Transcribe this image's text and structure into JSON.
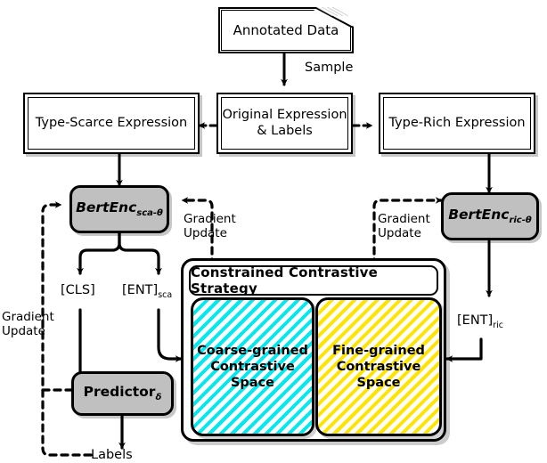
{
  "diagram": {
    "title": "Constrained Contrastive Strategy framework",
    "colors": {
      "coarse_hatch": "#00e8f0",
      "fine_hatch": "#ffe400",
      "process_fill": "#c0c0c0",
      "line": "#000000",
      "background": "#ffffff"
    }
  },
  "nodes": {
    "annotated_data": {
      "label": "Annotated Data"
    },
    "type_scarce": {
      "label": "Type-Scarce Expression"
    },
    "original": {
      "label_line1": "Original Expression",
      "label_line2": "& Labels"
    },
    "type_rich": {
      "label": "Type-Rich Expression"
    },
    "bert_sca": {
      "label": "BertEnc",
      "subscript": "sca-θ"
    },
    "bert_ric": {
      "label": "BertEnc",
      "subscript": "ric-θ"
    },
    "predictor": {
      "label": "Predictor",
      "subscript": "δ"
    },
    "ccs_panel": {
      "title": "Constrained Contrastive Strategy"
    },
    "coarse_space": {
      "label_line1": "Coarse-grained",
      "label_line2": "Contrastive Space"
    },
    "fine_space": {
      "label_line1": "Fine-grained",
      "label_line2": "Contrastive Space"
    }
  },
  "tokens": {
    "cls": {
      "label": "[CLS]"
    },
    "ent_sca": {
      "label": "[ENT]",
      "subscript": "sca"
    },
    "ent_ric": {
      "label": "[ENT]",
      "subscript": "ric"
    }
  },
  "edges": {
    "sample": {
      "label": "Sample"
    },
    "gradient_left": {
      "line1": "Gradient",
      "line2": "Update"
    },
    "gradient_center": {
      "line1": "Gradient",
      "line2": "Update"
    },
    "gradient_right": {
      "line1": "Gradient",
      "line2": "Update"
    },
    "labels_out": {
      "label": "Labels"
    }
  }
}
